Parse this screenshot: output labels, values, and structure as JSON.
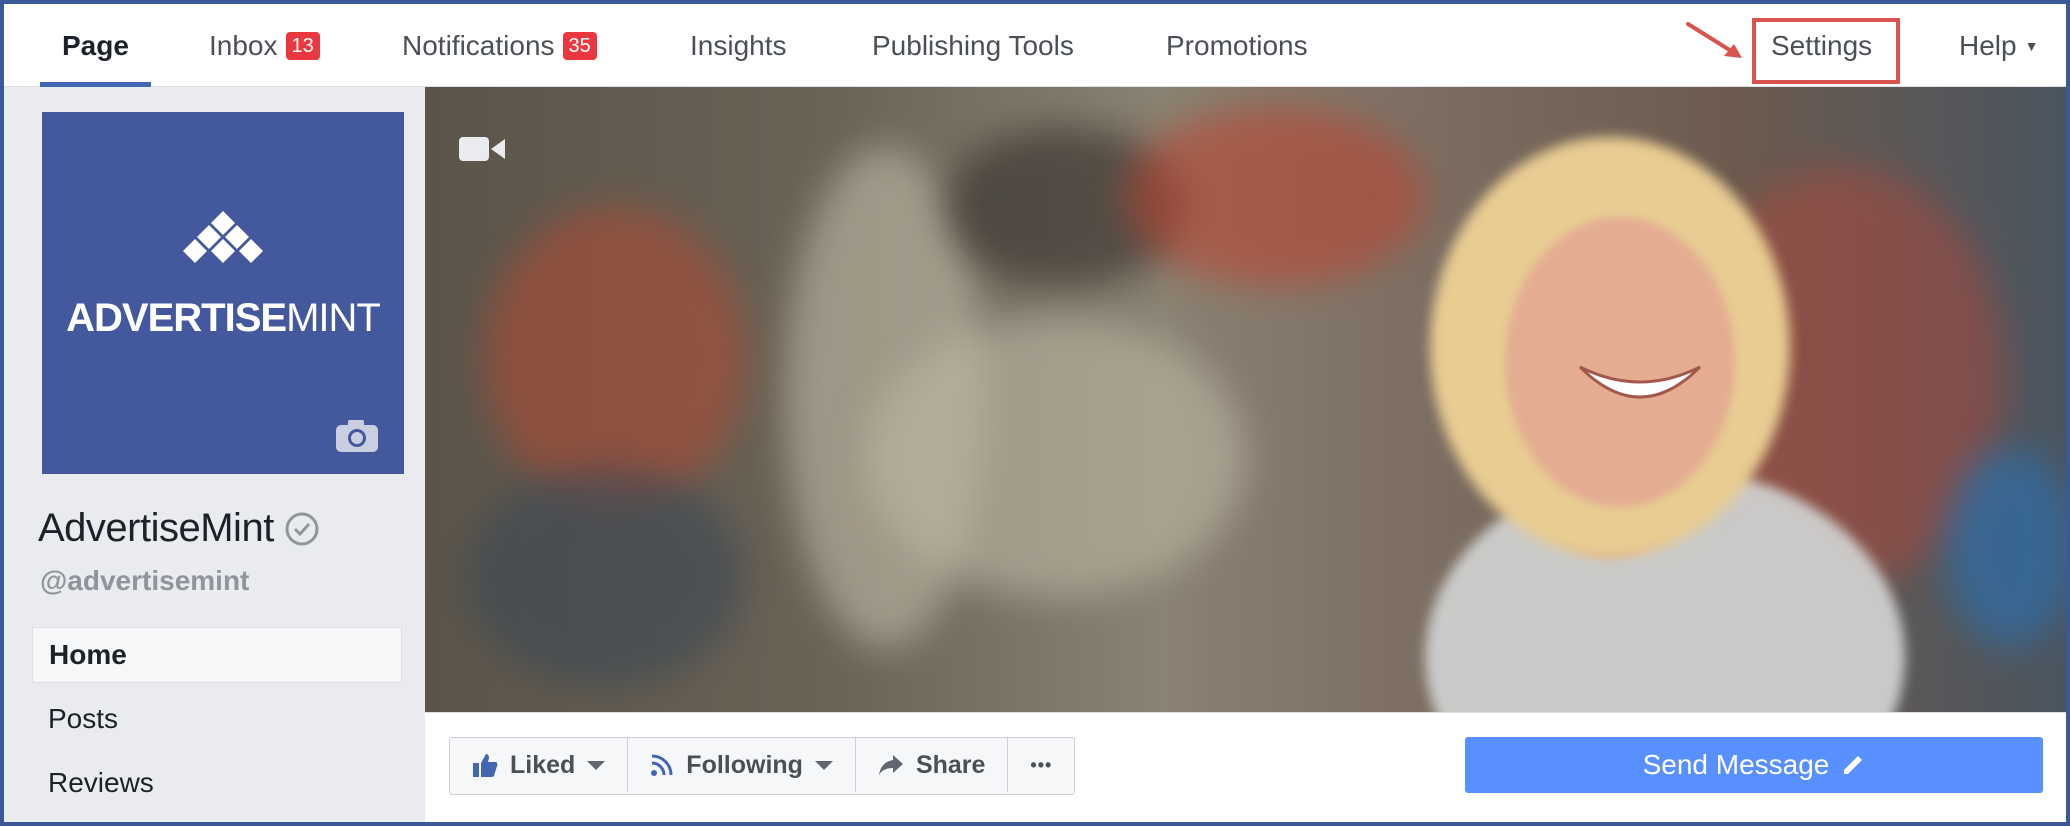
{
  "nav": {
    "items": [
      {
        "label": "Page",
        "active": true
      },
      {
        "label": "Inbox",
        "badge": "13"
      },
      {
        "label": "Notifications",
        "badge": "35"
      },
      {
        "label": "Insights"
      },
      {
        "label": "Publishing Tools"
      },
      {
        "label": "Promotions"
      }
    ],
    "settings": "Settings",
    "help": "Help"
  },
  "profile": {
    "logo_text_bold": "ADVERTISE",
    "logo_text_light": "MINT",
    "name": "AdvertiseMint",
    "handle": "@advertisemint"
  },
  "sidebar": {
    "items": [
      {
        "label": "Home",
        "active": true
      },
      {
        "label": "Posts"
      },
      {
        "label": "Reviews"
      }
    ]
  },
  "actions": {
    "liked": "Liked",
    "following": "Following",
    "share": "Share",
    "more": "•••",
    "send_message": "Send Message"
  },
  "colors": {
    "brand": "#43589d",
    "accent": "#4267b2",
    "send_button": "#5890ff",
    "badge": "#e9383f",
    "highlight": "#d9534f"
  }
}
